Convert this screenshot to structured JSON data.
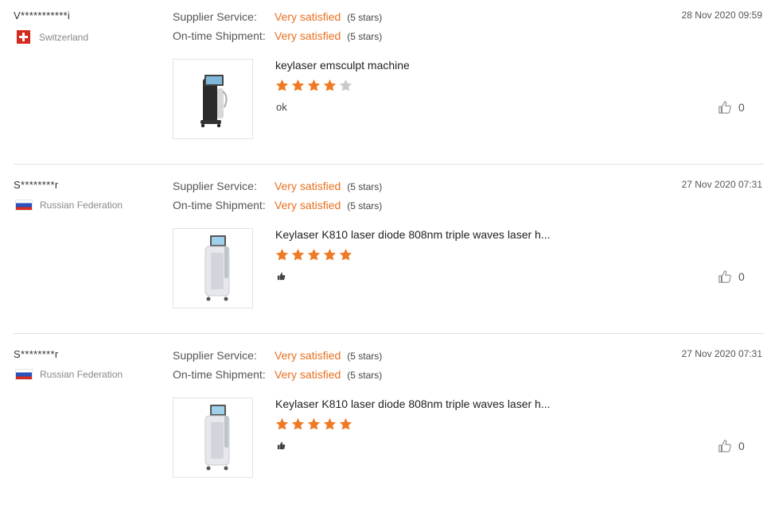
{
  "labels": {
    "supplier_service": "Supplier Service:",
    "ontime_shipment": "On-time Shipment:"
  },
  "colors": {
    "accent": "#e96f1e",
    "star_active": "#f07a24",
    "star_inactive": "#c9c9c9"
  },
  "reviews": [
    {
      "user": "V***********i",
      "country": "Switzerland",
      "flag": "switzerland-flag",
      "date": "28 Nov 2020 09:59",
      "supplier_service": "Very satisfied",
      "supplier_service_stars": "(5 stars)",
      "ontime_shipment": "Very satisfied",
      "ontime_shipment_stars": "(5 stars)",
      "product_title": "keylaser emsculpt machine",
      "rating": 4,
      "rating_max": 5,
      "comment": "ok",
      "likes": "0"
    },
    {
      "user": "S********r",
      "country": "Russian Federation",
      "flag": "russia-flag",
      "date": "27 Nov 2020 07:31",
      "supplier_service": "Very satisfied",
      "supplier_service_stars": "(5 stars)",
      "ontime_shipment": "Very satisfied",
      "ontime_shipment_stars": "(5 stars)",
      "product_title": "Keylaser K810 laser diode 808nm triple waves laser h...",
      "rating": 5,
      "rating_max": 5,
      "comment_icon": "thumbs-up-emoji-icon",
      "likes": "0"
    },
    {
      "user": "S********r",
      "country": "Russian Federation",
      "flag": "russia-flag",
      "date": "27 Nov 2020 07:31",
      "supplier_service": "Very satisfied",
      "supplier_service_stars": "(5 stars)",
      "ontime_shipment": "Very satisfied",
      "ontime_shipment_stars": "(5 stars)",
      "product_title": "Keylaser K810 laser diode 808nm triple waves laser h...",
      "rating": 5,
      "rating_max": 5,
      "comment_icon": "thumbs-up-emoji-icon",
      "likes": "0"
    }
  ]
}
